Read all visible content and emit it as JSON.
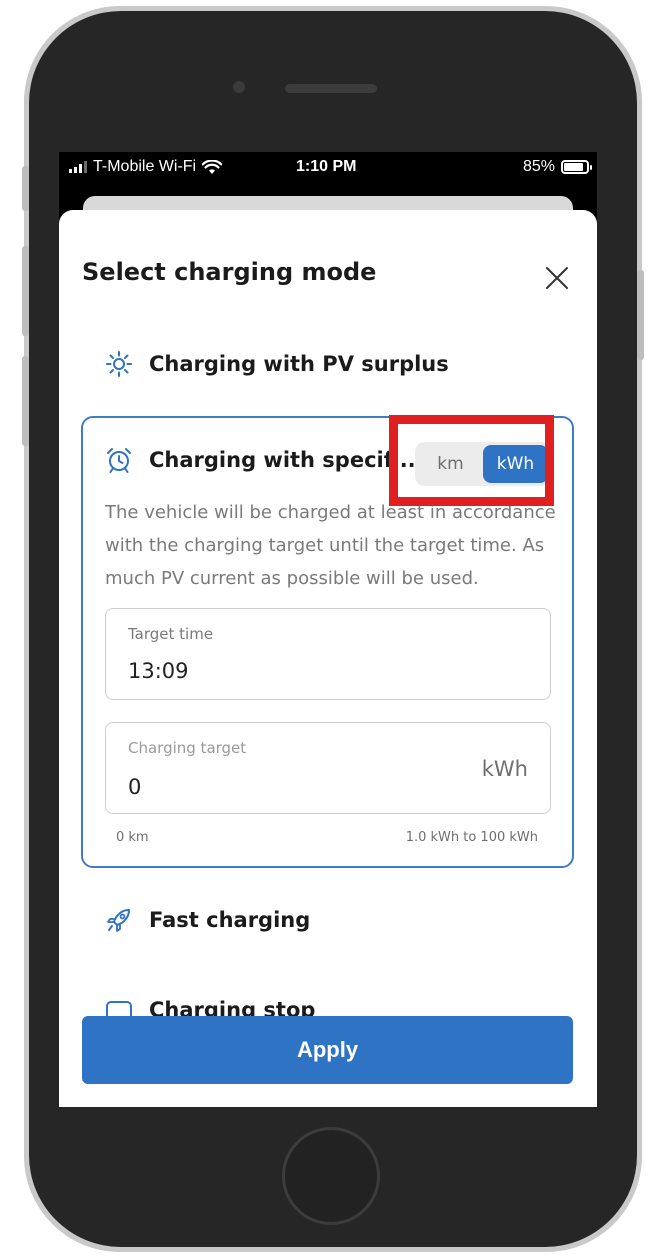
{
  "status_bar": {
    "carrier": "T-Mobile Wi-Fi",
    "time": "1:10 PM",
    "battery": "85%",
    "battery_level": 0.85
  },
  "sheet": {
    "title": "Select charging mode",
    "close_icon": "close-icon"
  },
  "options": {
    "pv_surplus": {
      "label": "Charging with PV surplus",
      "icon": "sun-icon"
    },
    "specific": {
      "label": "Charging with specif...",
      "icon": "alarm-clock-icon",
      "unit_toggle": {
        "options": [
          "km",
          "kWh"
        ],
        "selected": "kWh"
      },
      "description": "The vehicle will be charged at least in accordance with the charging target until the target time. As much PV current as possible will be used.",
      "target_time": {
        "label": "Target time",
        "value": "13:09"
      },
      "charging_target": {
        "label": "Charging target",
        "value": "0",
        "unit": "kWh"
      },
      "hint_left": "0 km",
      "hint_right": "1.0 kWh to 100 kWh"
    },
    "fast": {
      "label": "Fast charging",
      "icon": "rocket-icon"
    },
    "stop": {
      "label": "Charging stop",
      "icon": "stop-icon"
    }
  },
  "apply_label": "Apply",
  "colors": {
    "accent": "#2f73c5",
    "highlight": "#e02020"
  }
}
